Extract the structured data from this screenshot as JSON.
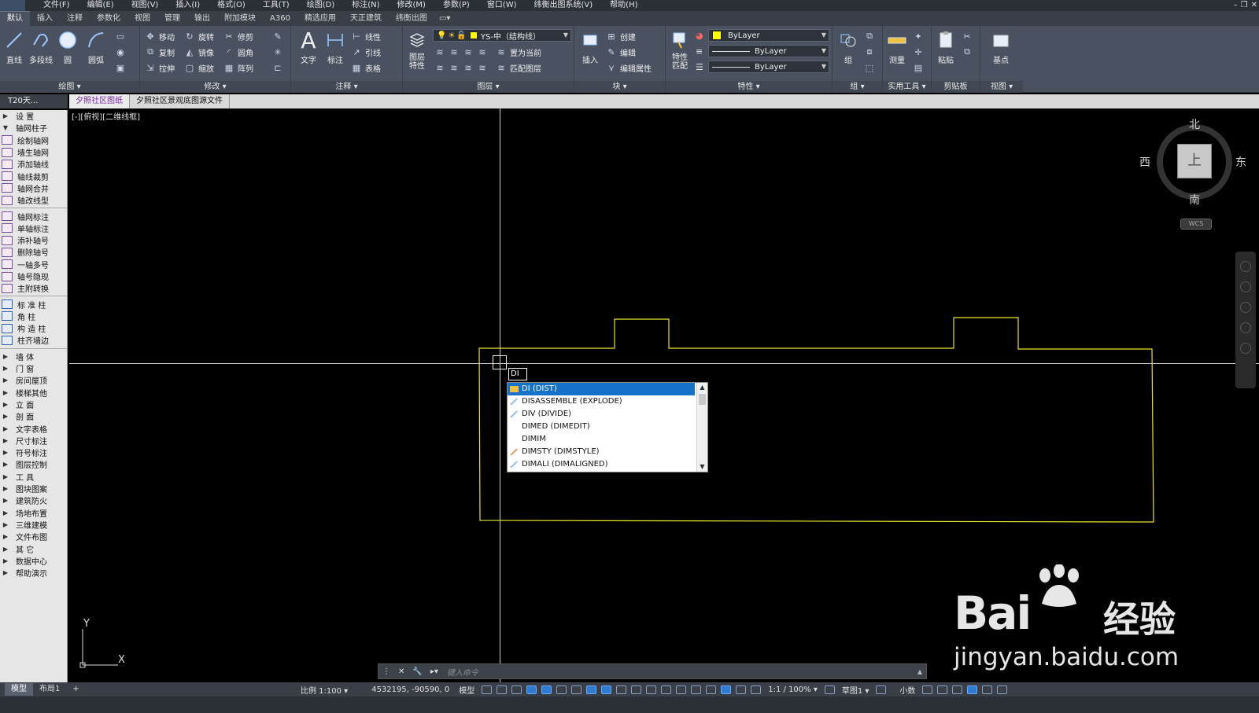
{
  "menubar": {
    "items": [
      "文件(F)",
      "编辑(E)",
      "视图(V)",
      "插入(I)",
      "格式(O)",
      "工具(T)",
      "绘图(D)",
      "标注(N)",
      "修改(M)",
      "参数(P)",
      "窗口(W)",
      "纬衡出图系统(V)",
      "帮助(H)"
    ]
  },
  "tabs": {
    "items": [
      "默认",
      "插入",
      "注释",
      "参数化",
      "视图",
      "管理",
      "输出",
      "附加模块",
      "A360",
      "精选应用",
      "天正建筑",
      "纬衡出图"
    ],
    "active": "默认"
  },
  "ribbon": {
    "draw": {
      "title": "绘图 ▾",
      "line": "直线",
      "polyline": "多段线",
      "circle": "圆",
      "arc": "圆弧"
    },
    "modify": {
      "title": "修改 ▾",
      "move": "移动",
      "rotate": "旋转",
      "trim": "修剪",
      "copy": "复制",
      "mirror": "镜像",
      "fillet": "圆角",
      "stretch": "拉伸",
      "scale": "缩放",
      "array": "阵列"
    },
    "annotate": {
      "title": "注释 ▾",
      "text": "文字",
      "dimension": "标注",
      "linear": "线性",
      "leader": "引线",
      "table": "表格"
    },
    "layers": {
      "title": "图层 ▾",
      "props": "图层\n特性",
      "layer_name": "YS-中（结构线）",
      "set_current": "置为当前",
      "match_layer": "匹配图层"
    },
    "block": {
      "title": "块 ▾",
      "insert": "插入",
      "create": "创建",
      "edit": "编辑",
      "edit_attr": "编辑属性"
    },
    "properties": {
      "title": "特性 ▾",
      "match": "特性\n匹配",
      "color": "ByLayer",
      "linetype": "ByLayer",
      "lineweight": "ByLayer"
    },
    "groups": {
      "title": "组 ▾",
      "group": "组"
    },
    "utilities": {
      "title": "实用工具 ▾",
      "measure": "测量"
    },
    "clipboard": {
      "title": "剪贴板",
      "paste": "粘贴"
    },
    "view": {
      "title": "视图 ▾",
      "base": "基点"
    }
  },
  "t20": {
    "header": "T20天...",
    "items": [
      {
        "label": "设    置",
        "type": "cat"
      },
      {
        "label": "轴网柱子",
        "type": "cat-open"
      },
      {
        "label": "绘制轴网",
        "type": "tool"
      },
      {
        "label": "墙生轴网",
        "type": "tool"
      },
      {
        "label": "添加轴线",
        "type": "tool"
      },
      {
        "label": "轴线裁剪",
        "type": "tool"
      },
      {
        "label": "轴网合并",
        "type": "tool"
      },
      {
        "label": "轴改线型",
        "type": "tool"
      },
      {
        "label": "sep",
        "type": "sep"
      },
      {
        "label": "轴网标注",
        "type": "tool"
      },
      {
        "label": "单轴标注",
        "type": "tool"
      },
      {
        "label": "添补轴号",
        "type": "tool"
      },
      {
        "label": "删除轴号",
        "type": "tool"
      },
      {
        "label": "一轴多号",
        "type": "tool"
      },
      {
        "label": "轴号隐现",
        "type": "tool"
      },
      {
        "label": "主附转换",
        "type": "tool"
      },
      {
        "label": "sep",
        "type": "sep"
      },
      {
        "label": "标 准 柱",
        "type": "tool"
      },
      {
        "label": "角    柱",
        "type": "tool"
      },
      {
        "label": "构 造 柱",
        "type": "tool"
      },
      {
        "label": "柱齐墙边",
        "type": "tool"
      },
      {
        "label": "sep",
        "type": "sep"
      },
      {
        "label": "墙    体",
        "type": "cat"
      },
      {
        "label": "门    窗",
        "type": "cat"
      },
      {
        "label": "房间屋顶",
        "type": "cat"
      },
      {
        "label": "楼梯其他",
        "type": "cat"
      },
      {
        "label": "立    面",
        "type": "cat"
      },
      {
        "label": "剖    面",
        "type": "cat"
      },
      {
        "label": "文字表格",
        "type": "cat"
      },
      {
        "label": "尺寸标注",
        "type": "cat"
      },
      {
        "label": "符号标注",
        "type": "cat"
      },
      {
        "label": "图层控制",
        "type": "cat"
      },
      {
        "label": "工    具",
        "type": "cat"
      },
      {
        "label": "图块图案",
        "type": "cat"
      },
      {
        "label": "建筑防火",
        "type": "cat"
      },
      {
        "label": "场地布置",
        "type": "cat"
      },
      {
        "label": "三维建模",
        "type": "cat"
      },
      {
        "label": "文件布图",
        "type": "cat"
      },
      {
        "label": "其    它",
        "type": "cat"
      },
      {
        "label": "数据中心",
        "type": "cat"
      },
      {
        "label": "帮助演示",
        "type": "cat"
      }
    ]
  },
  "doc_tabs": {
    "items": [
      "夕照社区图纸",
      "夕照社区景观底图源文件"
    ],
    "active": "夕照社区图纸"
  },
  "viewport": {
    "label": "[-][俯视][二维线框]",
    "command_text": "DI",
    "autocomplete": [
      {
        "label": "DI (DIST)",
        "icon": "measure-icon",
        "selected": true
      },
      {
        "label": "DISASSEMBLE (EXPLODE)",
        "icon": "explode-icon",
        "selected": false
      },
      {
        "label": "DIV (DIVIDE)",
        "icon": "divide-icon",
        "selected": false
      },
      {
        "label": "DIMED (DIMEDIT)",
        "icon": "",
        "selected": false
      },
      {
        "label": "DIMIM",
        "icon": "",
        "selected": false
      },
      {
        "label": "DIMSTY (DIMSTYLE)",
        "icon": "dimstyle-icon",
        "selected": false
      },
      {
        "label": "DIMALI (DIMALIGNED)",
        "icon": "dimaligned-icon",
        "selected": false
      }
    ],
    "viewcube": {
      "north": "北",
      "south": "南",
      "east": "东",
      "west": "西",
      "face": "上",
      "wcs": "WCS"
    },
    "ucs": {
      "x": "X",
      "y": "Y"
    },
    "cmdline_placeholder": "键入命令",
    "drawing_color": "#e6e62e"
  },
  "layout_tabs": {
    "items": [
      "模型",
      "布局1",
      "+"
    ],
    "active": "模型"
  },
  "statusbar": {
    "scale": "比例 1:100 ▾",
    "coords": "4532195, -90590, 0",
    "model": "模型",
    "annotation_scale": "1:1 / 100% ▾",
    "workspace": "草图1 ▾",
    "units": "小数"
  },
  "watermark": {
    "brand": "Bai",
    "brand_cn": "经验",
    "url": "jingyan.baidu.com"
  }
}
